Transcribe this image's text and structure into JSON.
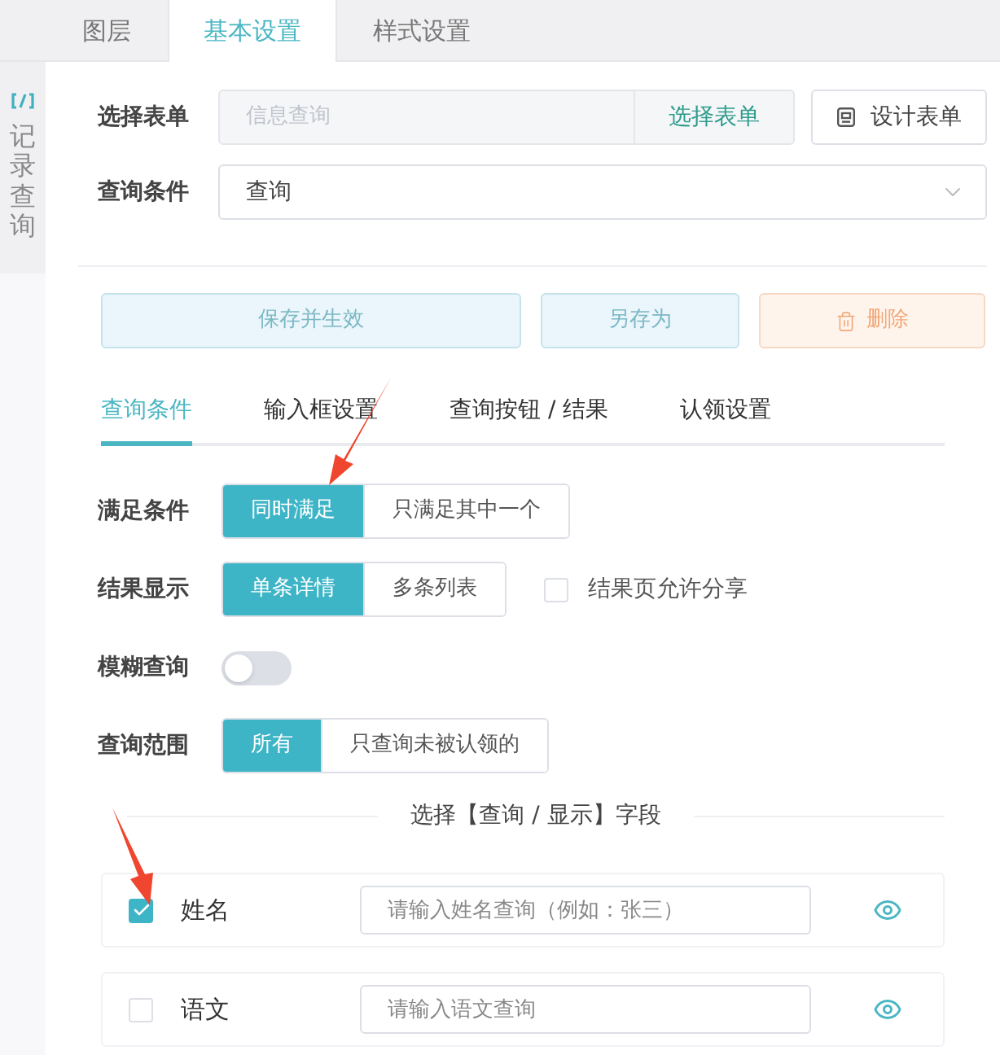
{
  "top_tabs": [
    {
      "label": "图层",
      "selected": false
    },
    {
      "label": "基本设置",
      "selected": true
    },
    {
      "label": "样式设置",
      "selected": false
    }
  ],
  "side_strip": {
    "title": "记录查询"
  },
  "form_select": {
    "label": "选择表单",
    "value": "信息查询",
    "disabled": true,
    "pick_button": "选择表单",
    "design_button": "设计表单"
  },
  "query_condition": {
    "label": "查询条件",
    "value": "查询"
  },
  "action_buttons": [
    {
      "label": "保存并生效",
      "kind": "primary"
    },
    {
      "label": "另存为",
      "kind": "primary"
    },
    {
      "label": "删除",
      "kind": "danger"
    }
  ],
  "sub_tabs": [
    {
      "label": "查询条件",
      "selected": true
    },
    {
      "label": "输入框设置",
      "selected": false
    },
    {
      "label": "查询按钮 / 结果",
      "selected": false
    },
    {
      "label": "认领设置",
      "selected": false
    }
  ],
  "settings": [
    {
      "kind": "segmented",
      "label": "满足条件",
      "options": [
        {
          "label": "同时满足",
          "selected": true
        },
        {
          "label": "只满足其中一个",
          "selected": false
        }
      ]
    },
    {
      "kind": "segmented",
      "label": "结果显示",
      "options": [
        {
          "label": "单条详情",
          "selected": true
        },
        {
          "label": "多条列表",
          "selected": false
        }
      ],
      "extra_checkbox": {
        "label": "结果页允许分享",
        "checked": false
      }
    },
    {
      "kind": "switch",
      "label": "模糊查询",
      "on": false
    },
    {
      "kind": "segmented",
      "label": "查询范围",
      "options": [
        {
          "label": "所有",
          "selected": true
        },
        {
          "label": "只查询未被认领的",
          "selected": false
        }
      ]
    }
  ],
  "fields_section": {
    "title": "选择【查询 / 显示】字段",
    "fields": [
      {
        "name": "姓名",
        "checked": true,
        "placeholder": "请输入姓名查询（例如：张三）",
        "visible": true
      },
      {
        "name": "语文",
        "checked": false,
        "placeholder": "请输入语文查询",
        "visible": true
      }
    ]
  }
}
